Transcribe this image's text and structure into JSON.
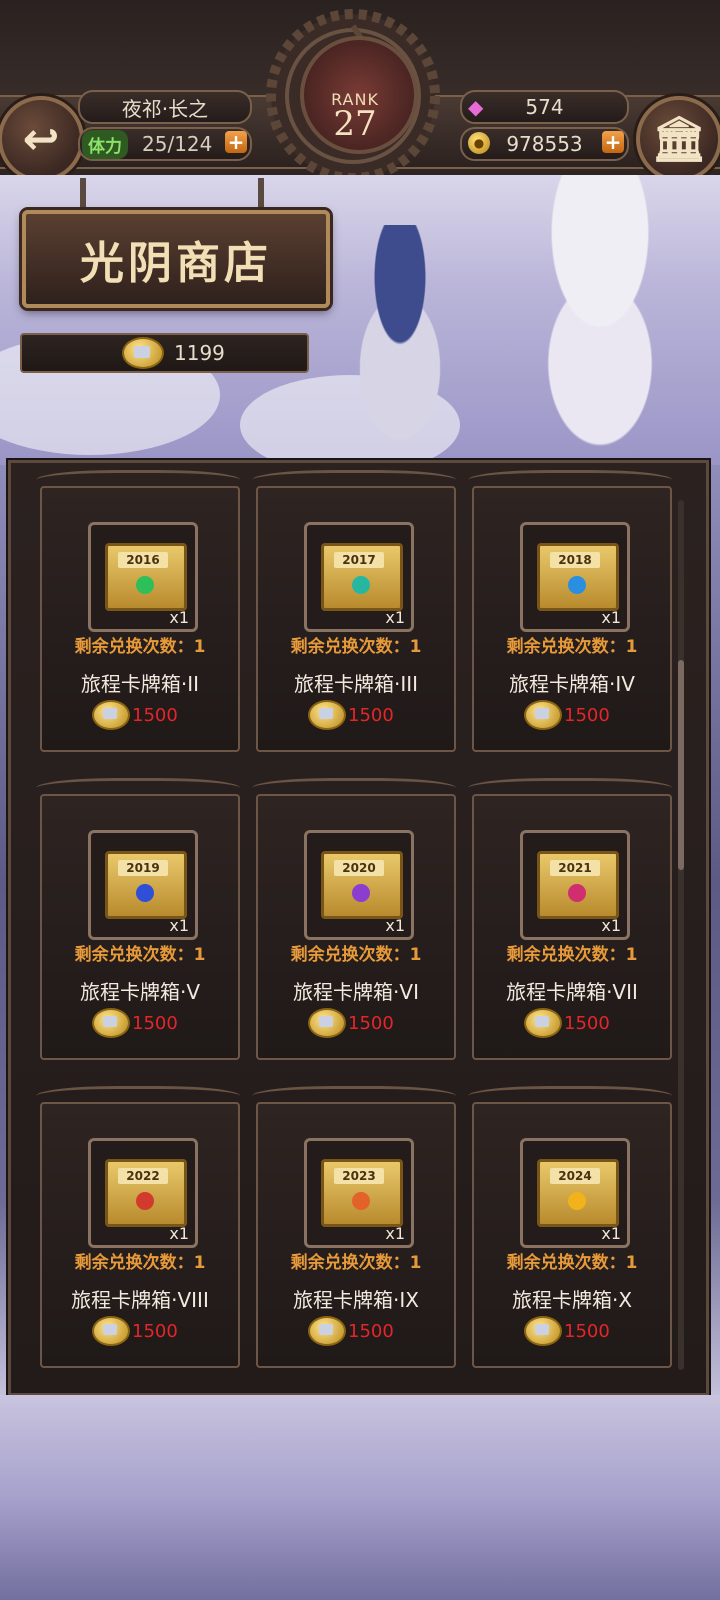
{
  "header": {
    "player_name": "夜祁·长之",
    "stamina_label": "体力",
    "stamina_value": "25/124",
    "rank_label": "RANK",
    "rank_value": "27",
    "gems": "574",
    "gold": "978553"
  },
  "banner": {
    "shop_title": "光阴商店",
    "currency_amount": "1199"
  },
  "shop": {
    "items": [
      {
        "year": "2016",
        "qty": "x1",
        "remain": "剩余兑换次数：1",
        "name": "旅程卡牌箱·II",
        "price": "1500",
        "gem_color": "#2fbf5a"
      },
      {
        "year": "2017",
        "qty": "x1",
        "remain": "剩余兑换次数：1",
        "name": "旅程卡牌箱·III",
        "price": "1500",
        "gem_color": "#27b7a1"
      },
      {
        "year": "2018",
        "qty": "x1",
        "remain": "剩余兑换次数：1",
        "name": "旅程卡牌箱·IV",
        "price": "1500",
        "gem_color": "#2a8fe0"
      },
      {
        "year": "2019",
        "qty": "x1",
        "remain": "剩余兑换次数：1",
        "name": "旅程卡牌箱·V",
        "price": "1500",
        "gem_color": "#2f4fd6"
      },
      {
        "year": "2020",
        "qty": "x1",
        "remain": "剩余兑换次数：1",
        "name": "旅程卡牌箱·VI",
        "price": "1500",
        "gem_color": "#8b3dd0"
      },
      {
        "year": "2021",
        "qty": "x1",
        "remain": "剩余兑换次数：1",
        "name": "旅程卡牌箱·VII",
        "price": "1500",
        "gem_color": "#d02e6f"
      },
      {
        "year": "2022",
        "qty": "x1",
        "remain": "剩余兑换次数：1",
        "name": "旅程卡牌箱·VIII",
        "price": "1500",
        "gem_color": "#d33a2e"
      },
      {
        "year": "2023",
        "qty": "x1",
        "remain": "剩余兑换次数：1",
        "name": "旅程卡牌箱·IX",
        "price": "1500",
        "gem_color": "#e2622a"
      },
      {
        "year": "2024",
        "qty": "x1",
        "remain": "剩余兑换次数：1",
        "name": "旅程卡牌箱·X",
        "price": "1500",
        "gem_color": "#f2b21c"
      }
    ]
  },
  "icons": {
    "back": "back-arrow-icon",
    "menu": "museum-icon",
    "gem": "gem-icon",
    "gold": "gold-coin-icon",
    "time_coin": "time-coin-icon"
  },
  "colors": {
    "price_red": "#e3262a",
    "remain_orange": "#e79a3a",
    "stamina_green": "#8de26a"
  }
}
